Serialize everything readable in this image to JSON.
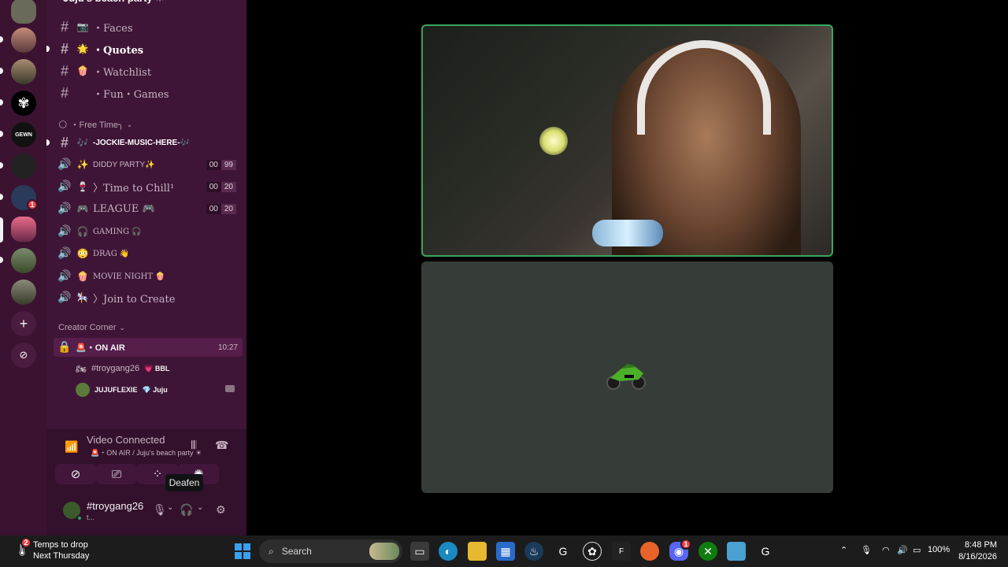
{
  "server": {
    "name": "Juju's beach party ☀"
  },
  "channels": {
    "text": [
      {
        "emoji": "📷",
        "name": "・Faces",
        "selected": false
      },
      {
        "emoji": "🌟",
        "name": "・Quotes",
        "selected": true
      },
      {
        "emoji": "🍿",
        "name": "・Watchlist",
        "selected": false
      },
      {
        "emoji": "",
        "name": "・Fun・Games",
        "selected": false
      }
    ],
    "category_free_time": "・Free Time╮",
    "music": {
      "emoji": "🎶",
      "name": "-JOCKIE-MUSIC-HERE-🎶"
    },
    "voice": [
      {
        "emoji": "✨",
        "name": "DIDDY PARTY✨",
        "count_a": "00",
        "count_b": "99"
      },
      {
        "emoji": "🍷",
        "name": "〉Time to Chill¹",
        "count_a": "00",
        "count_b": "20"
      },
      {
        "emoji": "🎮",
        "name": "LEAGUE 🎮",
        "count_a": "00",
        "count_b": "20"
      },
      {
        "emoji": "🎧",
        "name": "GAMING 🎧",
        "count_a": "",
        "count_b": ""
      },
      {
        "emoji": "😳",
        "name": "DRAG 👋",
        "count_a": "",
        "count_b": ""
      },
      {
        "emoji": "🍿",
        "name": "MOVIE NIGHT 🍿",
        "count_a": "",
        "count_b": ""
      },
      {
        "emoji": "🎠",
        "name": "〉Join to Create",
        "count_a": "",
        "count_b": ""
      }
    ],
    "category_creator": "Creator Corner",
    "on_air": {
      "emoji": "🚨",
      "name": "・ON AIR",
      "time": "10:27"
    },
    "members": [
      {
        "name": "#troygang26",
        "tag_emoji": "💗",
        "tag": "BBL"
      },
      {
        "name": "JUJUFLEXIE",
        "tag_emoji": "💎",
        "tag": "Juju"
      }
    ]
  },
  "voice_panel": {
    "title": "Video Connected",
    "subtitle": "🚨・ON AIR / Juju's beach party ☀",
    "tooltip": "Deafen"
  },
  "user": {
    "name": "#troygang26",
    "status": "t..."
  },
  "rail": {
    "badges": [
      "1"
    ]
  },
  "taskbar": {
    "weather_line1": "Temps to drop",
    "weather_line2": "Next Thursday",
    "weather_badge": "2",
    "search_placeholder": "Search",
    "battery": "100%",
    "time": "8:48 PM",
    "date": "8/16/2026",
    "discord_badge": "1"
  },
  "colors": {
    "speaking_border": "#3ba55d",
    "sidebar_bg": "#3f1537",
    "rail_bg": "#3b1330"
  }
}
